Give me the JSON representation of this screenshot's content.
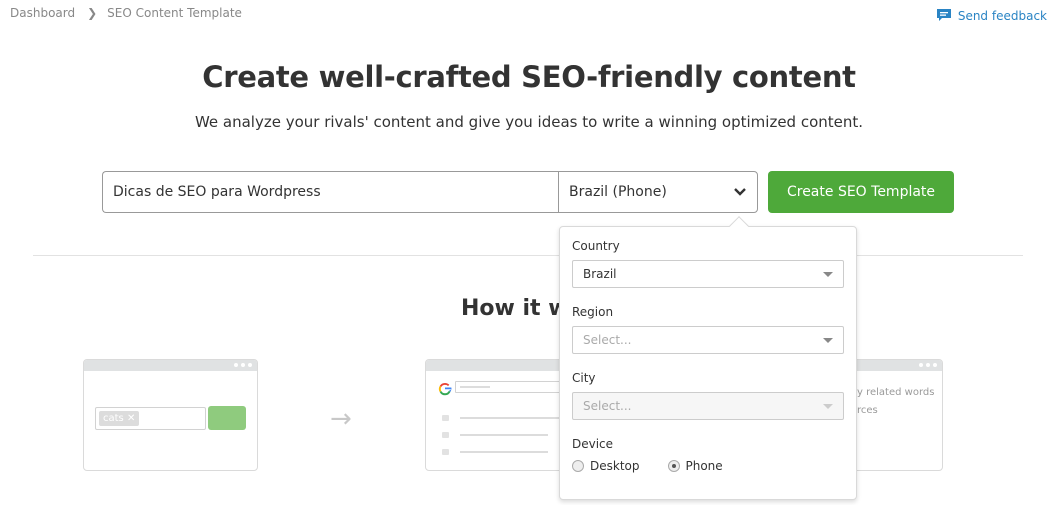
{
  "breadcrumb": {
    "items": [
      "Dashboard",
      "SEO Content Template"
    ]
  },
  "feedback": {
    "label": "Send feedback",
    "icon": "chat-bubble-icon",
    "color": "#2a84c4"
  },
  "hero": {
    "title": "Create well-crafted SEO-friendly content",
    "subtitle": "We analyze your rivals' content and give you ideas to write a winning optimized content."
  },
  "search": {
    "keyword_value": "Dicas de SEO para Wordpress",
    "database_value": "Brazil (Phone)",
    "create_button": "Create SEO Template",
    "accent_color": "#4ea93a"
  },
  "how_it_works": {
    "title": "How it works",
    "card1_tag": "cats",
    "card3_lines": [
      "y related words",
      "rces"
    ]
  },
  "popover": {
    "country_label": "Country",
    "country_value": "Brazil",
    "region_label": "Region",
    "region_placeholder": "Select...",
    "city_label": "City",
    "city_placeholder": "Select...",
    "device_label": "Device",
    "device_options": [
      "Desktop",
      "Phone"
    ],
    "device_selected": "Phone"
  }
}
